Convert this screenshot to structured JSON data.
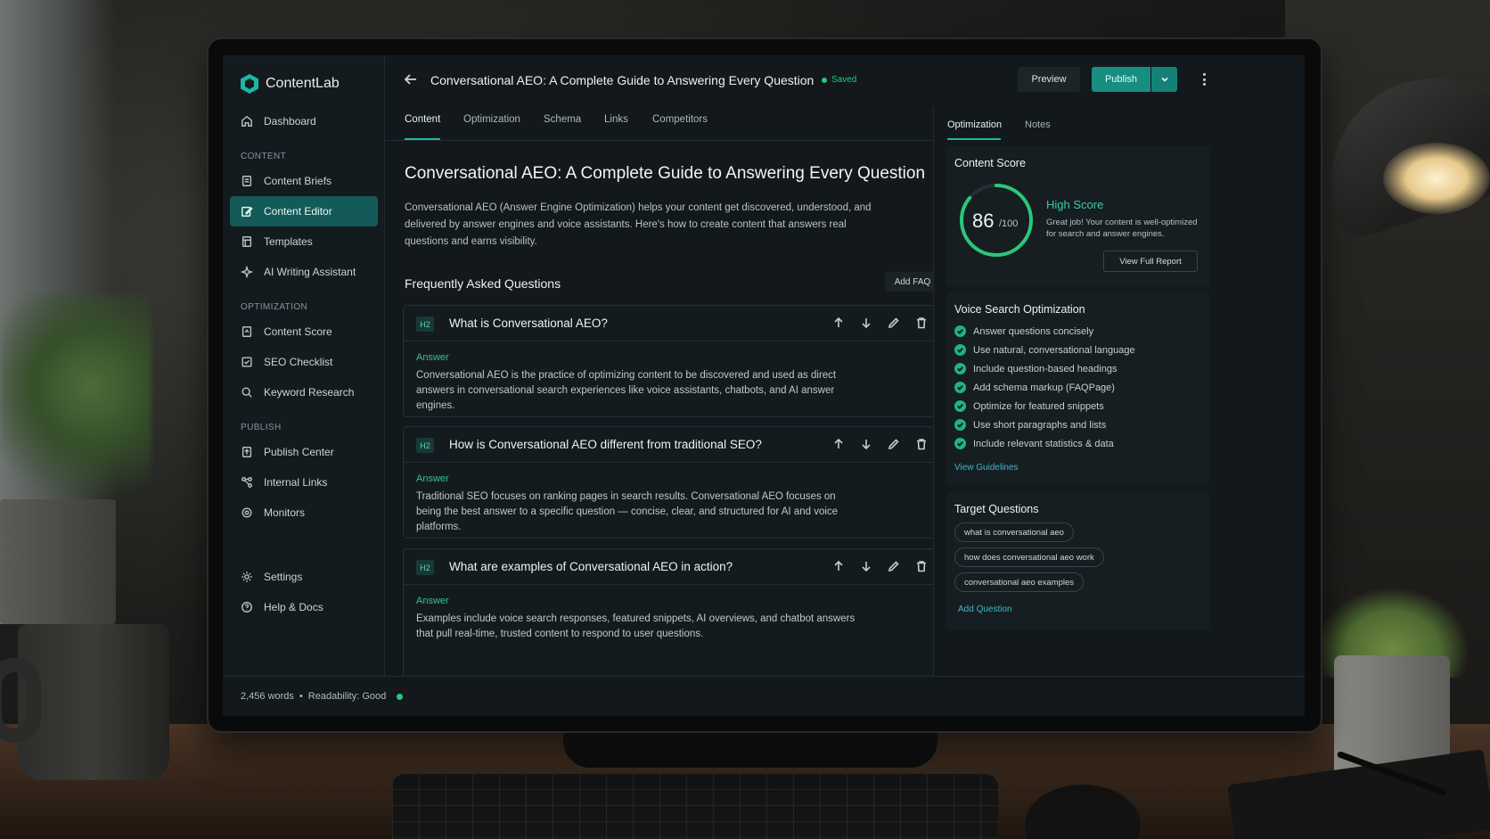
{
  "app": {
    "name": "ContentLab"
  },
  "sidebar": {
    "dashboard": "Dashboard",
    "sections": {
      "content": "CONTENT",
      "optimization": "OPTIMIZATION",
      "publish": "PUBLISH"
    },
    "content_items": [
      {
        "label": "Content Briefs",
        "icon": "document-icon"
      },
      {
        "label": "Content Editor",
        "icon": "edit-icon",
        "active": true
      },
      {
        "label": "Templates",
        "icon": "template-icon"
      },
      {
        "label": "AI Writing Assistant",
        "icon": "sparkle-icon"
      }
    ],
    "optimization_items": [
      {
        "label": "Content Score",
        "icon": "score-icon"
      },
      {
        "label": "SEO Checklist",
        "icon": "checklist-icon"
      },
      {
        "label": "Keyword Research",
        "icon": "search-icon"
      }
    ],
    "publish_items": [
      {
        "label": "Publish Center",
        "icon": "publish-icon"
      },
      {
        "label": "Internal Links",
        "icon": "link-icon"
      },
      {
        "label": "Monitors",
        "icon": "monitor-icon"
      }
    ],
    "bottom_items": [
      {
        "label": "Settings",
        "icon": "gear-icon"
      },
      {
        "label": "Help & Docs",
        "icon": "help-icon"
      }
    ]
  },
  "header": {
    "title": "Conversational AEO: A Complete Guide to Answering Every Question",
    "saved": "Saved",
    "preview": "Preview",
    "publish": "Publish"
  },
  "tabs": [
    "Content",
    "Optimization",
    "Schema",
    "Links",
    "Competitors"
  ],
  "main": {
    "title": "Conversational AEO: A Complete Guide to Answering Every Question",
    "intro": "Conversational AEO (Answer Engine Optimization) helps your content get discovered, understood, and delivered by answer engines and voice assistants. Here's how to create content that answers real questions and earns visibility.",
    "faq_heading": "Frequently Asked Questions",
    "add_faq": "Add FAQ",
    "faqs": [
      {
        "badge": "H2",
        "question": "What is Conversational AEO?",
        "answer_label": "Answer",
        "answer": "Conversational AEO is the practice of optimizing content to be discovered and used as direct answers in conversational search experiences like voice assistants, chatbots, and AI answer engines."
      },
      {
        "badge": "H2",
        "question": "How is Conversational AEO different from traditional SEO?",
        "answer_label": "Answer",
        "answer": "Traditional SEO focuses on ranking pages in search results. Conversational AEO focuses on being the best answer to a specific question — concise, clear, and structured for AI and voice platforms."
      },
      {
        "badge": "H2",
        "question": "What are examples of Conversational AEO in action?",
        "answer_label": "Answer",
        "answer": "Examples include voice search responses, featured snippets, AI overviews, and chatbot answers that pull real-time, trusted content to respond to user questions."
      }
    ]
  },
  "status_bar": {
    "words": "2,456 words",
    "separator": "•",
    "readability": "Readability: Good"
  },
  "right_panel": {
    "tabs": [
      "Optimization",
      "Notes"
    ],
    "content_score": {
      "title": "Content Score",
      "score": "86",
      "max": "/100",
      "score_fraction": 0.86,
      "label": "High Score",
      "description": "Great job! Your content is well-optimized for search and answer engines.",
      "button": "View Full Report"
    },
    "voice_search": {
      "title": "Voice Search Optimization",
      "items": [
        "Answer questions concisely",
        "Use natural, conversational language",
        "Include question-based headings",
        "Add schema markup (FAQPage)",
        "Optimize for featured snippets",
        "Use short paragraphs and lists",
        "Include relevant statistics & data"
      ],
      "link": "View Guidelines"
    },
    "target_questions": {
      "title": "Target Questions",
      "items": [
        "what is conversational aeo",
        "how does conversational aeo work",
        "conversational aeo examples"
      ],
      "link": "Add Question"
    }
  },
  "colors": {
    "accent": "#1fb5a5",
    "success": "#2bc77a",
    "active_nav": "#135a58",
    "link": "#3fb7c8"
  }
}
